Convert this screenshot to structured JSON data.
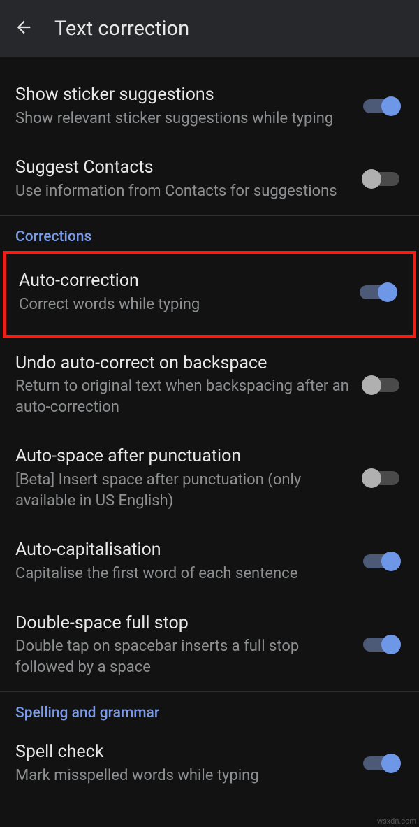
{
  "header": {
    "title": "Text correction"
  },
  "sections": [
    {
      "items": [
        {
          "id": "show-sticker-suggestions",
          "title": "Show sticker suggestions",
          "subtitle": "Show relevant sticker suggestions while typing",
          "enabled": true
        },
        {
          "id": "suggest-contacts",
          "title": "Suggest Contacts",
          "subtitle": "Use information from Contacts for suggestions",
          "enabled": false
        }
      ]
    },
    {
      "header": "Corrections",
      "items": [
        {
          "id": "auto-correction",
          "title": "Auto-correction",
          "subtitle": "Correct words while typing",
          "enabled": true,
          "highlighted": true
        },
        {
          "id": "undo-auto-correct",
          "title": "Undo auto-correct on backspace",
          "subtitle": "Return to original text when backspacing after an auto-correction",
          "enabled": false
        },
        {
          "id": "auto-space-punctuation",
          "title": "Auto-space after punctuation",
          "subtitle": "[Beta] Insert space after punctuation (only available in US English)",
          "enabled": false
        },
        {
          "id": "auto-capitalisation",
          "title": "Auto-capitalisation",
          "subtitle": "Capitalise the first word of each sentence",
          "enabled": true
        },
        {
          "id": "double-space-full-stop",
          "title": "Double-space full stop",
          "subtitle": "Double tap on spacebar inserts a full stop followed by a space",
          "enabled": true
        }
      ]
    },
    {
      "header": "Spelling and grammar",
      "items": [
        {
          "id": "spell-check",
          "title": "Spell check",
          "subtitle": "Mark misspelled words while typing",
          "enabled": true
        }
      ]
    }
  ],
  "watermark": "wsxdn.com"
}
